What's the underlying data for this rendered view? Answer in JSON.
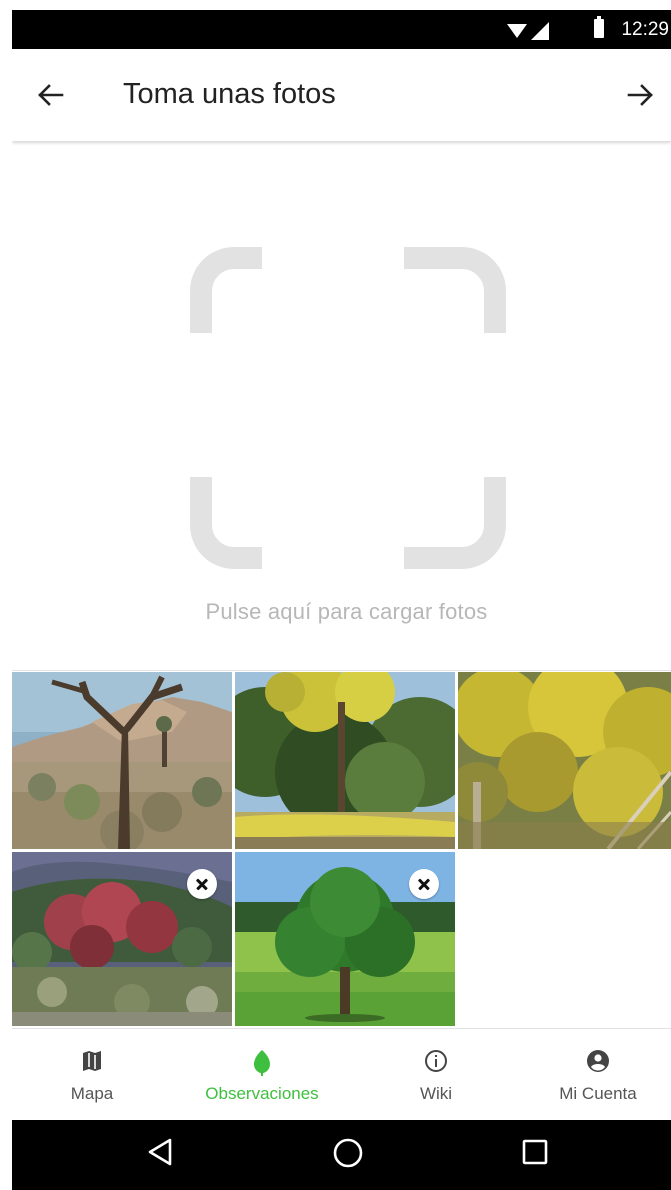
{
  "status_bar": {
    "time": "12:29"
  },
  "header": {
    "title": "Toma unas fotos",
    "back_icon": "arrow-left-icon",
    "next_icon": "arrow-right-icon"
  },
  "upload": {
    "hint": "Pulse aquí para cargar fotos",
    "icon": "image-frame-icon"
  },
  "photos": [
    {
      "subject": "joshua-tree-desert",
      "removable": false
    },
    {
      "subject": "yellow-flowering-tree-meadow",
      "removable": false
    },
    {
      "subject": "yellow-acacia-bush",
      "removable": false
    },
    {
      "subject": "red-leaved-shrub",
      "removable": true
    },
    {
      "subject": "green-oak-tree-field",
      "removable": true
    }
  ],
  "bottom_nav": {
    "items": [
      {
        "label": "Mapa",
        "icon": "map-icon",
        "active": false
      },
      {
        "label": "Observaciones",
        "icon": "leaf-icon",
        "active": true
      },
      {
        "label": "Wiki",
        "icon": "info-icon",
        "active": false
      },
      {
        "label": "Mi Cuenta",
        "icon": "account-icon",
        "active": false
      }
    ]
  },
  "colors": {
    "accent": "#3fbf3f",
    "placeholder": "#e2e2e2",
    "hint_text": "#b7b7b7"
  }
}
